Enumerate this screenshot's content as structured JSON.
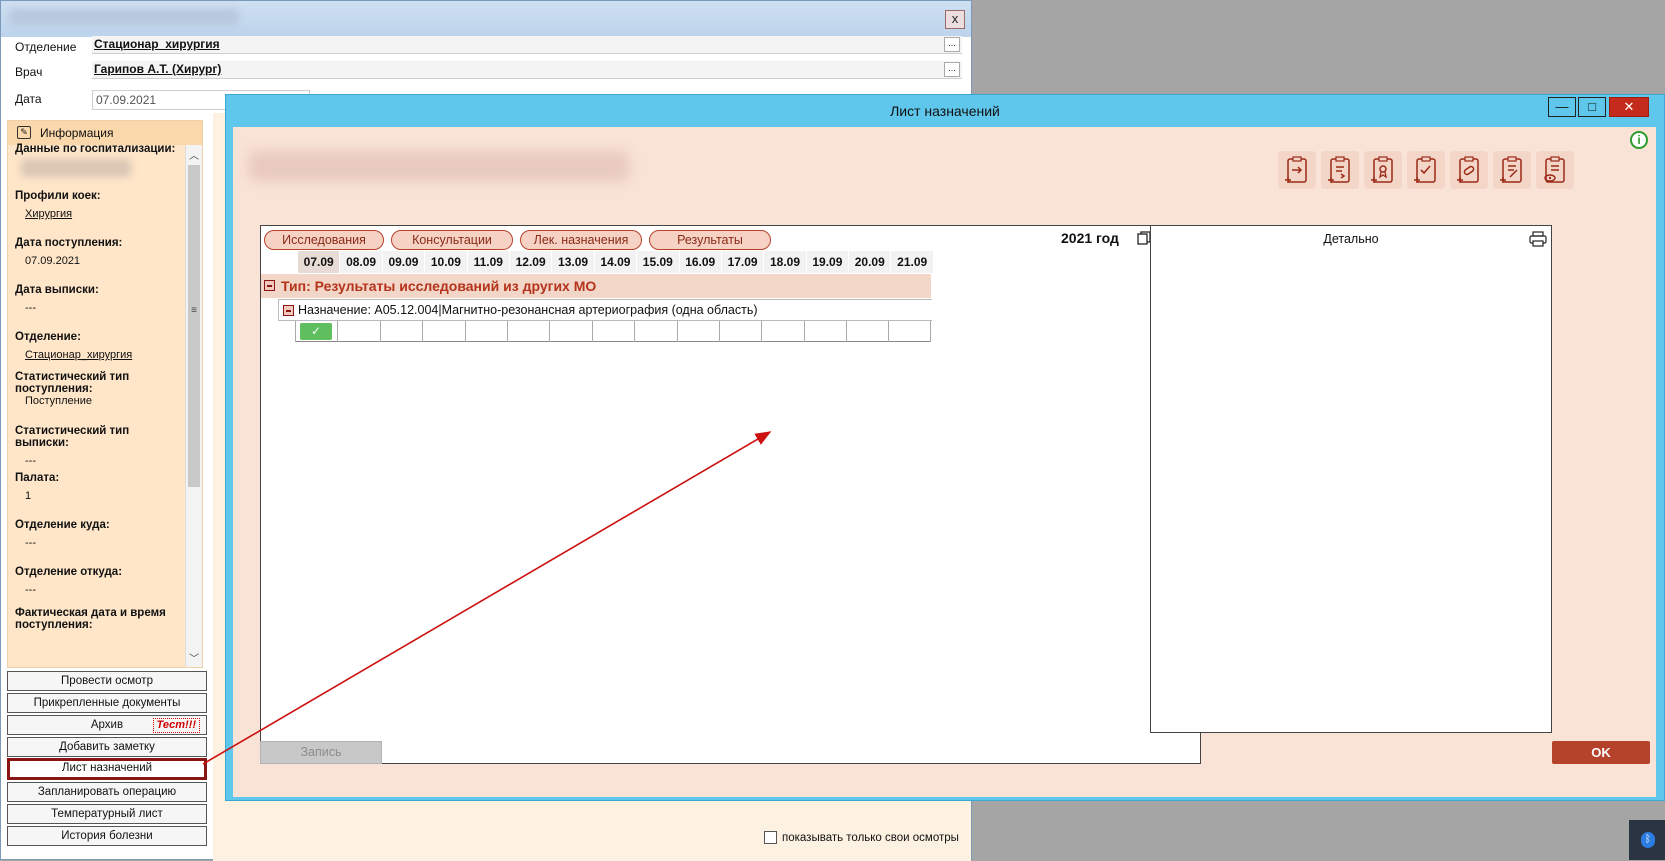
{
  "background_window": {
    "close_label": "x",
    "fields": {
      "department_label": "Отделение",
      "department_value": "Стационар_хирургия",
      "doctor_label": "Врач",
      "doctor_value": "Гарипов А.Т. (Хирург)",
      "date_label": "Дата",
      "date_value": "07.09.2021",
      "ellipsis": "..."
    },
    "info_panel": {
      "header": "Информация",
      "items": [
        {
          "label": "Данные по госпитализации:",
          "value": ""
        },
        {
          "label": "Профили коек:",
          "value": "Хирургия"
        },
        {
          "label": "Дата поступления:",
          "value": "07.09.2021"
        },
        {
          "label": "Дата выписки:",
          "value": "---"
        },
        {
          "label": "Отделение:",
          "value": "Стационар_хирургия"
        },
        {
          "label": "Статистический тип поступления:",
          "value": "Поступление"
        },
        {
          "label": "Статистический тип выписки:",
          "value": "---"
        },
        {
          "label": "Палата:",
          "value": "1"
        },
        {
          "label": "Отделение куда:",
          "value": "---"
        },
        {
          "label": "Отделение откуда:",
          "value": "---"
        },
        {
          "label": "Фактическая дата и время поступления:",
          "value": ""
        }
      ]
    },
    "side_buttons": [
      "Провести осмотр",
      "Прикрепленные документы",
      "Архив",
      "Добавить заметку",
      "Лист назначений",
      "Запланировать операцию",
      "Температурный лист",
      "История болезни"
    ],
    "test_label": "Тест!!!",
    "own_exams_checkbox": "показывать только свои осмотры"
  },
  "dialog": {
    "title": "Лист назначений",
    "minimize": "—",
    "maximize": "□",
    "close": "✕",
    "tabs": [
      "Исследования",
      "Консультации",
      "Лек. назначения",
      "Результаты"
    ],
    "year": "2021 год",
    "dates": [
      "07.09",
      "08.09",
      "09.09",
      "10.09",
      "11.09",
      "12.09",
      "13.09",
      "14.09",
      "15.09",
      "16.09",
      "17.09",
      "18.09",
      "19.09",
      "20.09",
      "21.09"
    ],
    "group_title": "Тип: Результаты исследований из других МО",
    "assignment": "Назначение: A05.12.004|Магнитно-резонансная артериография (одна область)",
    "check_mark": "✓",
    "detail_title": "Детально",
    "save_button": "Запись",
    "ok_button": "OK",
    "info_icon": "i",
    "toolbar_icons": [
      "clipboard-arrow-icon",
      "clipboard-list-arrow-icon",
      "clipboard-award-icon",
      "clipboard-check-icon",
      "clipboard-pill-icon",
      "clipboard-edit-icon",
      "clipboard-eye-icon"
    ]
  },
  "colors": {
    "dialog_titlebar": "#5fc7ec",
    "dialog_body": "#f9e3d6",
    "accent": "#b5432b",
    "annotation_arrow": "#cc1111"
  }
}
